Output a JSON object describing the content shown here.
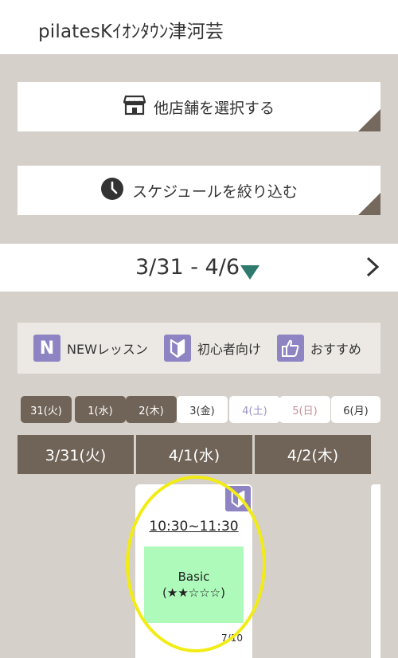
{
  "header": {
    "title": "pilatesKｲｵﾝﾀｳﾝ津河芸"
  },
  "buttons": {
    "store": {
      "label": "他店舗を選択する",
      "icon": "store-icon"
    },
    "schedule": {
      "label": "スケジュールを絞り込む",
      "icon": "clock-icon"
    }
  },
  "week": {
    "range": "3/31 - 4/6",
    "next_icon": "chevron-right-icon"
  },
  "legend": [
    {
      "icon": "new-lesson-icon",
      "glyph": "N",
      "label": "NEWレッスン"
    },
    {
      "icon": "beginner-icon",
      "label": "初心者向け"
    },
    {
      "icon": "thumbs-up-icon",
      "label": "おすすめ"
    }
  ],
  "day_tabs": [
    {
      "label": "31(火)",
      "state": "past"
    },
    {
      "label": "1(水)",
      "state": "past"
    },
    {
      "label": "2(木)",
      "state": "past"
    },
    {
      "label": "3(金)",
      "state": "future"
    },
    {
      "label": "4(土)",
      "state": "saturday"
    },
    {
      "label": "5(日)",
      "state": "sunday"
    },
    {
      "label": "6(月)",
      "state": "future"
    }
  ],
  "columns": [
    "3/31(火)",
    "4/1(水)",
    "4/2(木)"
  ],
  "lesson": {
    "time": "10:30~11:30",
    "name": "Basic",
    "difficulty": "(★★☆☆☆)",
    "capacity": "7/10",
    "badge": "beginner-icon"
  },
  "colors": {
    "accent_brown": "#706357",
    "accent_purple": "#8e84c4",
    "accent_teal": "#2f7a6e",
    "lesson_green": "#aefabb",
    "highlight_yellow": "#f2ec14"
  }
}
